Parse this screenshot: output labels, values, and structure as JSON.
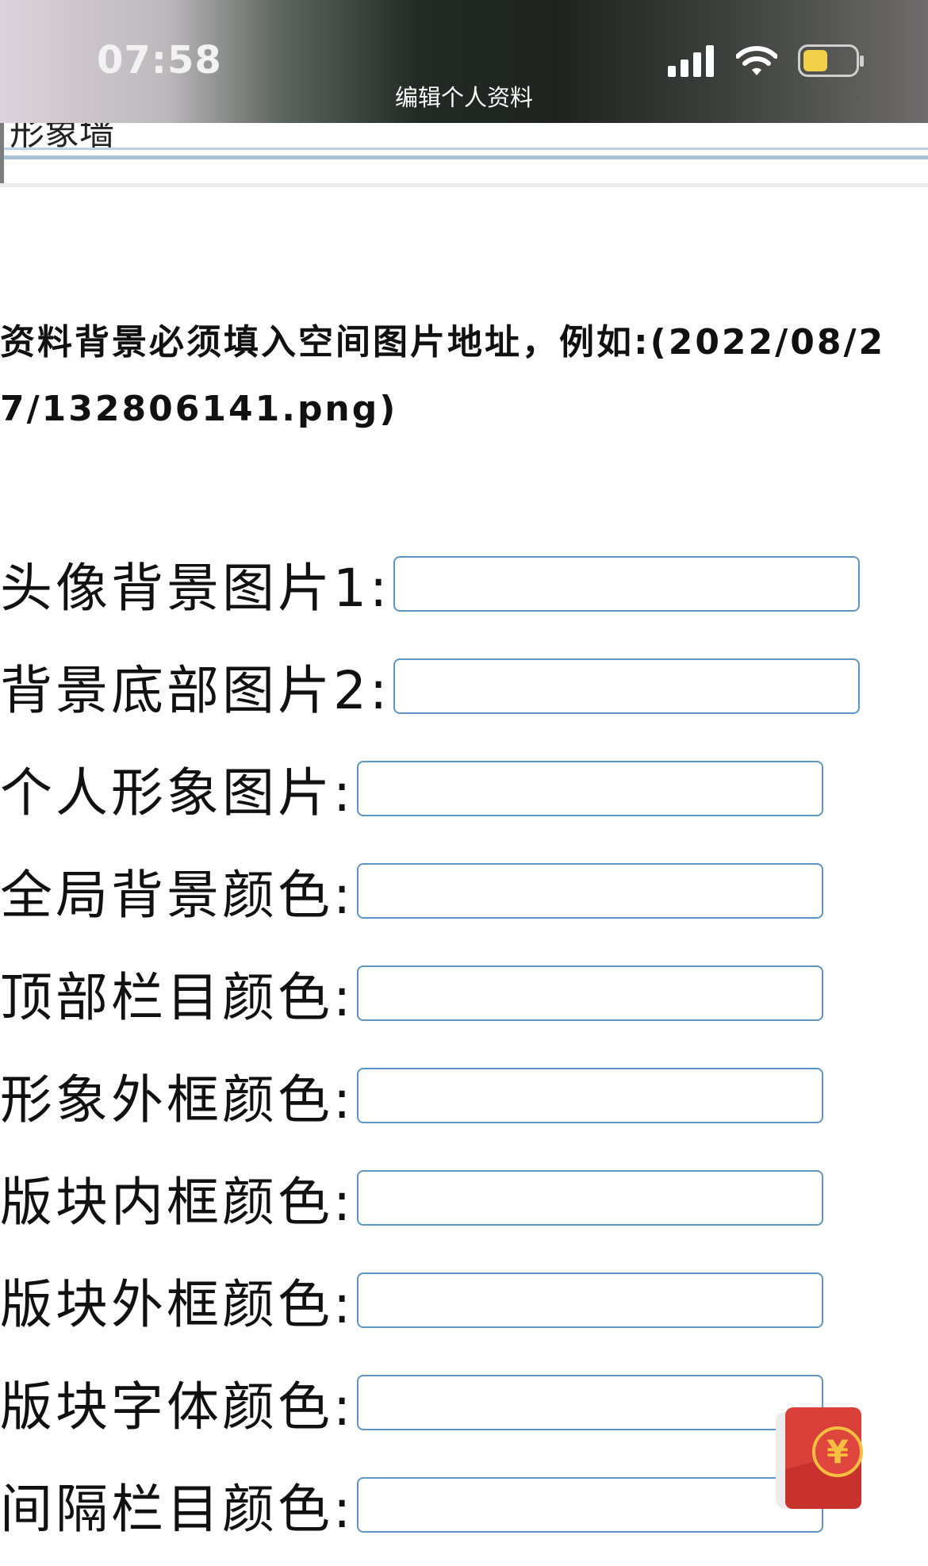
{
  "status_bar": {
    "time": "07:58"
  },
  "header": {
    "title": "编辑个人资料"
  },
  "previous_section": {
    "label": "形象墙"
  },
  "notice": {
    "text": "资料背景必须填入空间图片地址，例如:(2022/08/27/132806141.png)"
  },
  "form": {
    "fields": [
      {
        "label": "头像背景图片1:",
        "value": ""
      },
      {
        "label": "背景底部图片2:",
        "value": ""
      },
      {
        "label": "个人形象图片:",
        "value": ""
      },
      {
        "label": "全局背景颜色:",
        "value": ""
      },
      {
        "label": "顶部栏目颜色:",
        "value": ""
      },
      {
        "label": "形象外框颜色:",
        "value": ""
      },
      {
        "label": "版块内框颜色:",
        "value": ""
      },
      {
        "label": "版块外框颜色:",
        "value": ""
      },
      {
        "label": "版块字体颜色:",
        "value": ""
      },
      {
        "label": "间隔栏目颜色:",
        "value": ""
      }
    ]
  },
  "floating": {
    "icon": "red-envelope-icon",
    "symbol": "¥"
  },
  "colors": {
    "input_border": "#5d95c6",
    "envelope_red": "#d9403a",
    "envelope_gold": "#f5c040"
  }
}
